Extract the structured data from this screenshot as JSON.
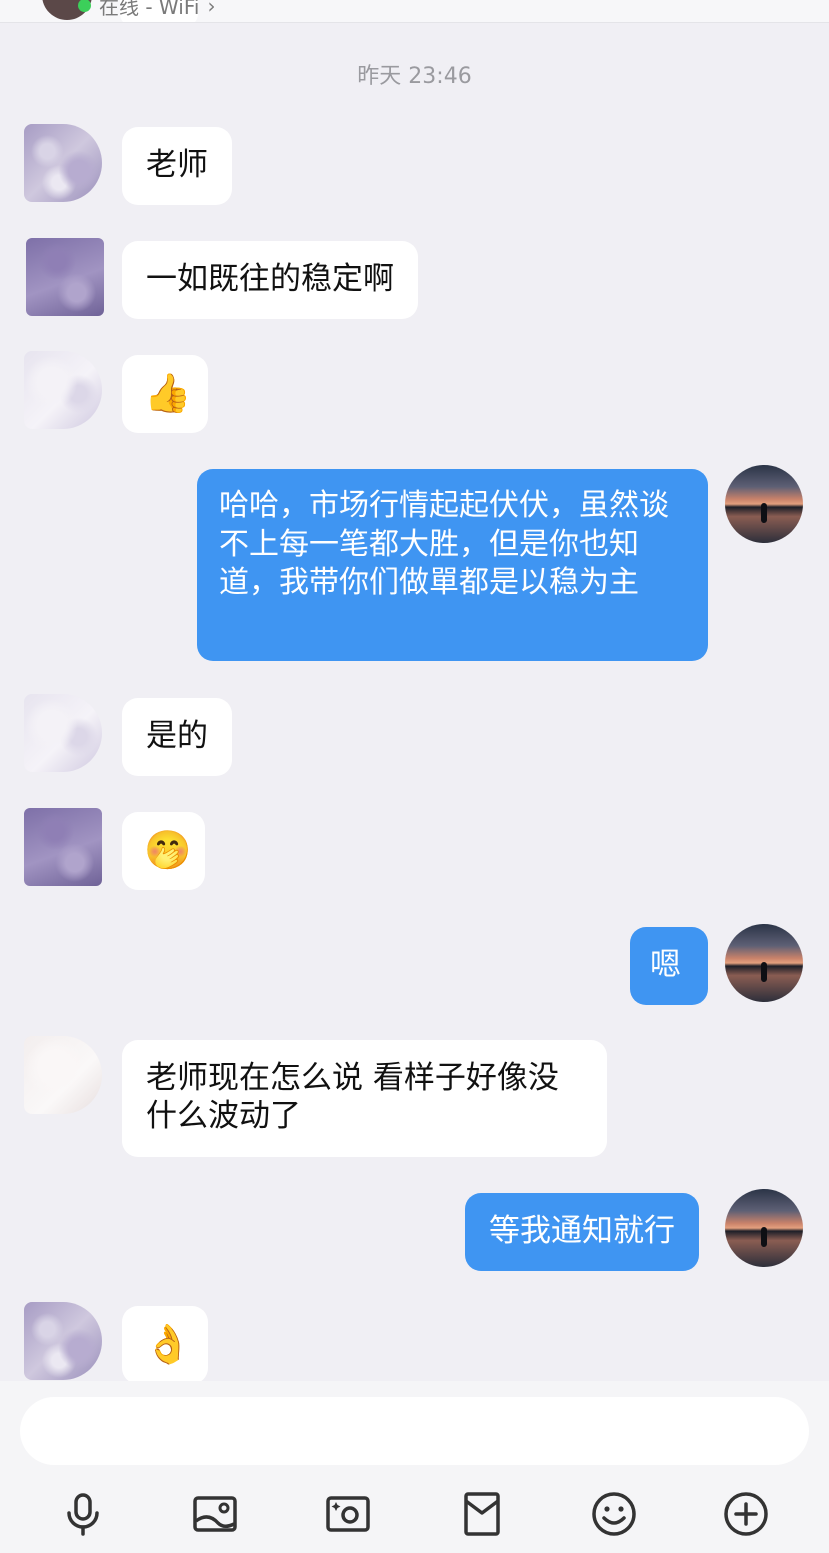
{
  "header": {
    "status": "在线 - WiFi",
    "status_chevron": "›",
    "online_color": "#3ccf5a"
  },
  "timestamp": "昨天 23:46",
  "colors": {
    "outgoing_bubble": "#3f95f2",
    "incoming_bubble": "#ffffff",
    "background": "#f0eff4"
  },
  "messages": [
    {
      "from": "other",
      "text": "老师"
    },
    {
      "from": "other",
      "text": "一如既往的稳定啊"
    },
    {
      "from": "other",
      "text": "👍",
      "emoji": true
    },
    {
      "from": "me",
      "text": "哈哈，市场行情起起伏伏，虽然谈不上每一笔都大胜，但是你也知道，我带你们做單都是以稳为主"
    },
    {
      "from": "other",
      "text": "是的"
    },
    {
      "from": "other",
      "text": "🤭",
      "emoji": true
    },
    {
      "from": "me",
      "text": "嗯"
    },
    {
      "from": "other",
      "text": "老师现在怎么说 看样子好像没什么波动了"
    },
    {
      "from": "me",
      "text": "等我通知就行"
    },
    {
      "from": "other",
      "text": "👌",
      "emoji": true
    }
  ],
  "composer": {
    "input_value": "",
    "tools": [
      {
        "icon": "microphone-icon"
      },
      {
        "icon": "image-icon"
      },
      {
        "icon": "camera-icon"
      },
      {
        "icon": "red-packet-icon"
      },
      {
        "icon": "emoji-icon"
      },
      {
        "icon": "plus-icon"
      }
    ]
  }
}
